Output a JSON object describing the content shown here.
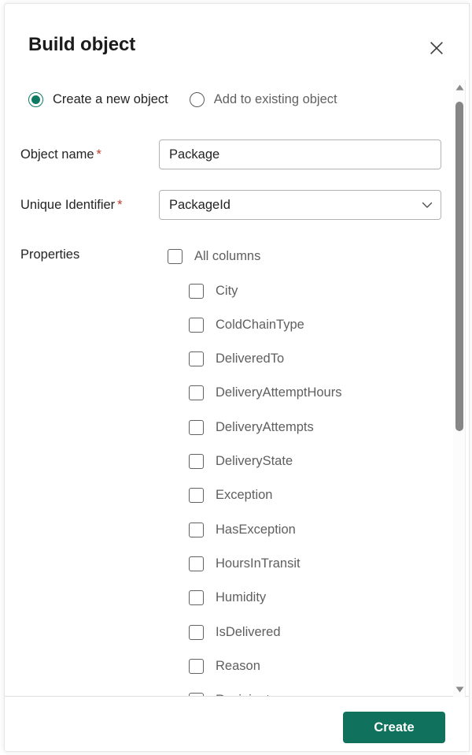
{
  "dialog": {
    "title": "Build object",
    "close_icon": "close-icon"
  },
  "mode": {
    "options": [
      {
        "label": "Create a new object",
        "selected": true
      },
      {
        "label": "Add to existing object",
        "selected": false
      }
    ]
  },
  "fields": {
    "object_name": {
      "label": "Object name",
      "required_marker": "*",
      "value": "Package",
      "placeholder": ""
    },
    "unique_identifier": {
      "label": "Unique Identifier",
      "required_marker": "*",
      "value": "PackageId",
      "caret_icon": "chevron-down-icon"
    },
    "properties": {
      "label": "Properties",
      "all_columns_label": "All columns",
      "all_columns_checked": false,
      "items": [
        {
          "label": "City",
          "checked": false
        },
        {
          "label": "ColdChainType",
          "checked": false
        },
        {
          "label": "DeliveredTo",
          "checked": false
        },
        {
          "label": "DeliveryAttemptHours",
          "checked": false
        },
        {
          "label": "DeliveryAttempts",
          "checked": false
        },
        {
          "label": "DeliveryState",
          "checked": false
        },
        {
          "label": "Exception",
          "checked": false
        },
        {
          "label": "HasException",
          "checked": false
        },
        {
          "label": "HoursInTransit",
          "checked": false
        },
        {
          "label": "Humidity",
          "checked": false
        },
        {
          "label": "IsDelivered",
          "checked": false
        },
        {
          "label": "Reason",
          "checked": false
        },
        {
          "label": "Recipient",
          "checked": false
        }
      ]
    }
  },
  "footer": {
    "create_label": "Create"
  },
  "scrollbar": {
    "up_icon": "scroll-up-arrow-icon",
    "down_icon": "scroll-down-arrow-icon"
  },
  "colors": {
    "accent_green": "#10715c",
    "radio_green": "#0f7a63",
    "required_red": "#c0392b"
  }
}
